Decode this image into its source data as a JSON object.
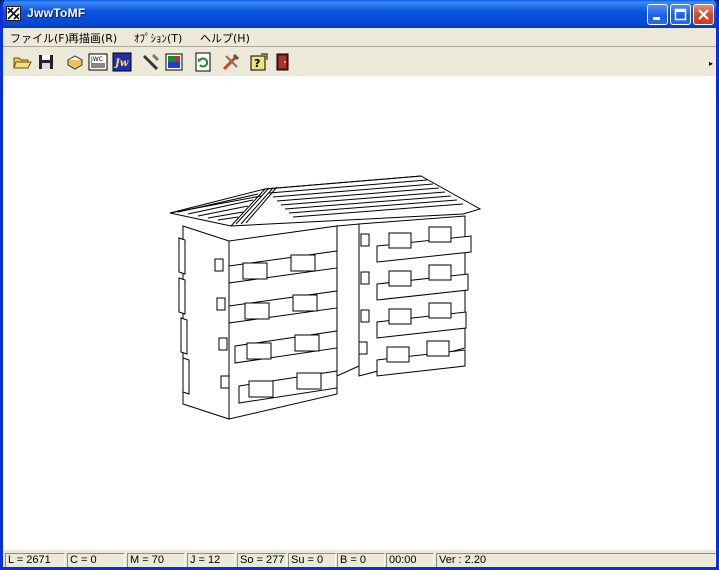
{
  "window": {
    "title": "JwwToMF"
  },
  "menu": [
    {
      "label": "ファイル(F)"
    },
    {
      "label": "再描画(R)"
    },
    {
      "label": "ｵﾌﾟｼｮﾝ(T)"
    },
    {
      "label": "ヘルプ(H)"
    }
  ],
  "toolbar": {
    "buttons": [
      {
        "icon": "open-folder-icon"
      },
      {
        "icon": "save-disk-icon"
      },
      {
        "icon": "open-drawing-icon"
      },
      {
        "icon": "jwc-icon"
      },
      {
        "icon": "jw-icon"
      },
      {
        "icon": "tools-icon"
      },
      {
        "icon": "screen-icon"
      },
      {
        "icon": "refresh-icon"
      },
      {
        "icon": "settings-icon"
      },
      {
        "icon": "help-icon"
      },
      {
        "icon": "exit-icon"
      }
    ],
    "jwc_text": "JWC",
    "jw_text": "Jw"
  },
  "status": {
    "L": "L = 2671",
    "C": "C = 0",
    "M": "M = 70",
    "J": "J = 12",
    "So": "So = 277",
    "Su": "Su = 0",
    "B": "B = 0",
    "time": "00:00",
    "ver": "Ver : 2.20"
  }
}
